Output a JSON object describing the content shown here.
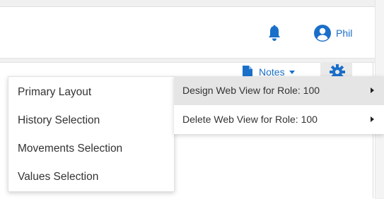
{
  "header": {
    "notifications_icon": "bell-icon",
    "user_icon": "user-avatar-icon",
    "user_name": "Phil"
  },
  "toolbar": {
    "notes_label": "Notes",
    "notes_icon": "document-icon",
    "settings_icon": "gear-icon"
  },
  "dropdown": {
    "items": [
      {
        "label": "Primary Layout"
      },
      {
        "label": "History Selection"
      },
      {
        "label": "Movements Selection"
      },
      {
        "label": "Values Selection"
      }
    ]
  },
  "submenu": {
    "items": [
      {
        "label": "Design Web View for Role: 100",
        "active": true
      },
      {
        "label": "Delete Web View for Role: 100",
        "active": false
      }
    ]
  },
  "colors": {
    "accent": "#1a6fc9",
    "menu_hover": "#e5e5e5",
    "text": "#333333"
  }
}
